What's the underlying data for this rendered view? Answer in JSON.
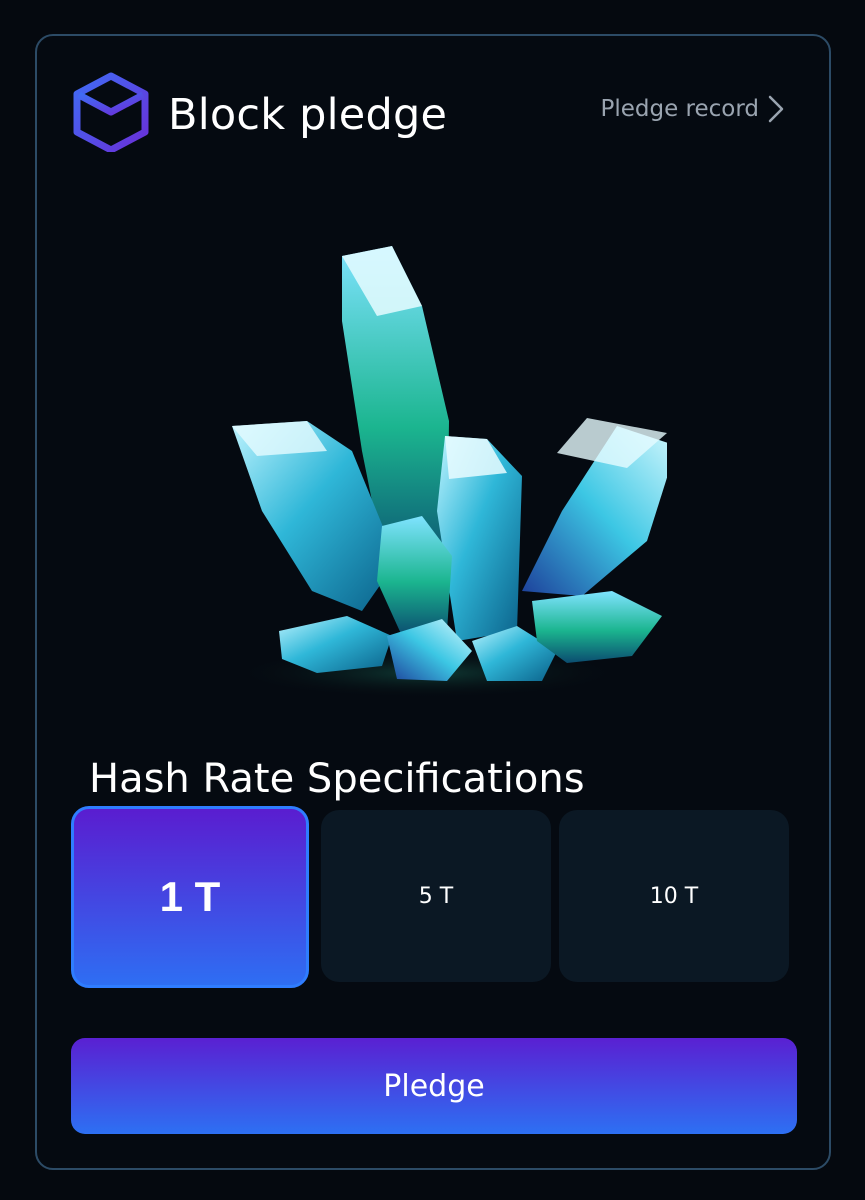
{
  "header": {
    "title": "Block pledge",
    "record_label": "Pledge record",
    "logo_icon": "cube-icon",
    "record_icon": "chevron-right-icon"
  },
  "illustration": {
    "subject": "crystal-cluster-icon"
  },
  "specs": {
    "title": "Hash Rate Specifications",
    "options": [
      {
        "label": "1 T",
        "selected": true
      },
      {
        "label": "5 T",
        "selected": false
      },
      {
        "label": "10 T",
        "selected": false
      }
    ]
  },
  "action": {
    "pledge_label": "Pledge"
  },
  "colors": {
    "background": "#05090f",
    "card_border": "#2c4b66",
    "accent_purple": "#5a1dd0",
    "accent_blue": "#2e6ef3",
    "option_bg": "#0b1824",
    "muted_text": "#9aa4b0"
  }
}
